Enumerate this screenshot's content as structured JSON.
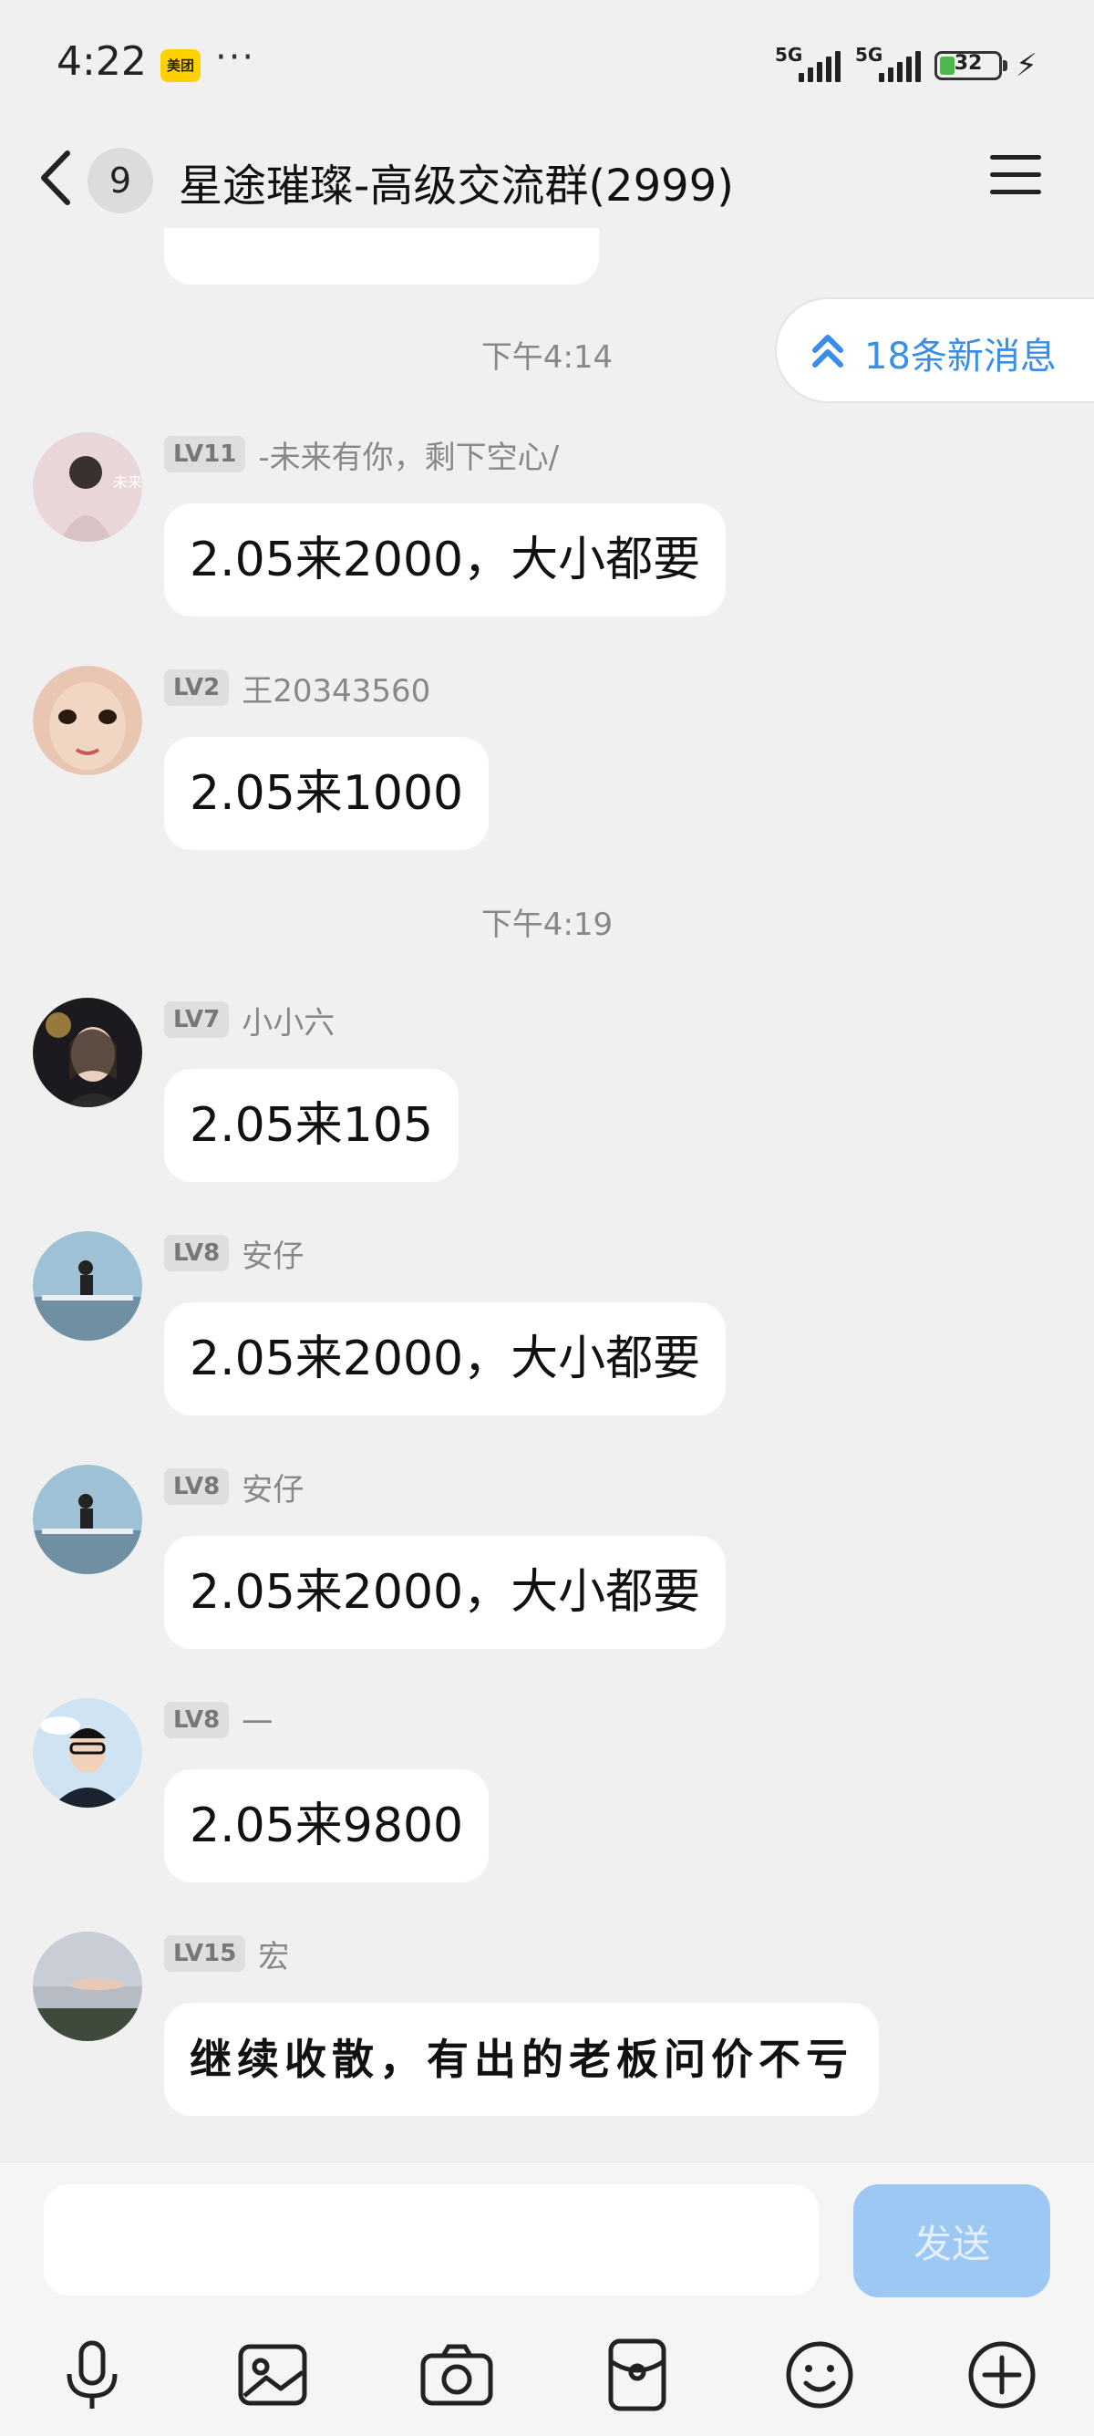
{
  "status": {
    "time": "4:22",
    "app_badge": "美团",
    "dots": "···",
    "sig1": "5G",
    "sig2": "5G",
    "battery": "32",
    "battery_fraction": 0.32
  },
  "header": {
    "unread_count": "9",
    "title": "星途璀璨-高级交流群(2999)"
  },
  "new_messages": {
    "label": "18条新消息"
  },
  "timestamps": [
    "下午4:14",
    "下午4:19"
  ],
  "messages": [
    {
      "level": "LV11",
      "name": "-未来有你，剩下空心/",
      "text": "2.05来2000，大小都要"
    },
    {
      "level": "LV2",
      "name": "王20343560",
      "text": "2.05来1000"
    },
    {
      "level": "LV7",
      "name": "小小六",
      "text": "2.05来105"
    },
    {
      "level": "LV8",
      "name": "安仔",
      "text": "2.05来2000，大小都要"
    },
    {
      "level": "LV8",
      "name": "安仔",
      "text": "2.05来2000，大小都要"
    },
    {
      "level": "LV8",
      "name": "一",
      "text": "2.05来9800"
    },
    {
      "level": "LV15",
      "name": "宏",
      "text": "继续收散，有出的老板问价不亏"
    }
  ],
  "input": {
    "value": "",
    "placeholder": ""
  },
  "send": {
    "label": "发送"
  },
  "toolbar_icons": [
    "microphone-icon",
    "image-icon",
    "camera-icon",
    "red-packet-icon",
    "emoji-icon",
    "plus-icon"
  ],
  "colors": {
    "accent": "#3a8ee6",
    "send_disabled": "#9cc8f3",
    "background": "#f0f0f0"
  }
}
